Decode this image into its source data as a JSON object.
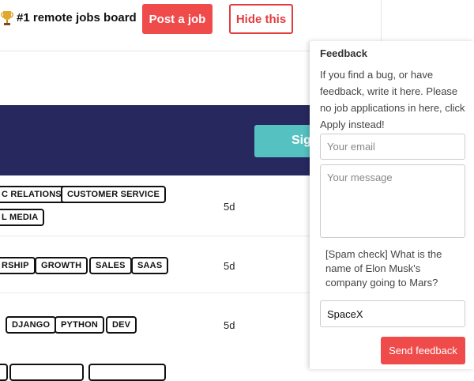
{
  "header": {
    "trophy_icon": "trophy-icon",
    "brand": "#1 remote jobs board",
    "post_job_label": "Post a job",
    "hide_label": "Hide this",
    "accent": "#ef4b4b"
  },
  "banner": {
    "background": "#27285e",
    "button_label": "Sig",
    "button_color": "#55c1c1"
  },
  "jobs": [
    {
      "tags": [
        "C RELATIONS",
        "CUSTOMER SERVICE",
        "L MEDIA"
      ],
      "age": "5d"
    },
    {
      "tags": [
        "RSHIP",
        "GROWTH",
        "SALES",
        "SAAS"
      ],
      "age": "5d"
    },
    {
      "tags": [
        "DJANGO",
        "PYTHON",
        "DEV"
      ],
      "age": "5d"
    }
  ],
  "feedback": {
    "title": "Feedback",
    "description": "If you find a bug, or have feedback, write it here. Please no job applications in here, click Apply instead!",
    "email_placeholder": "Your email",
    "message_placeholder": "Your message",
    "spam_question": "[Spam check] What is the name of Elon Musk's company going to Mars?",
    "spam_answer": "SpaceX",
    "send_label": "Send feedback"
  }
}
